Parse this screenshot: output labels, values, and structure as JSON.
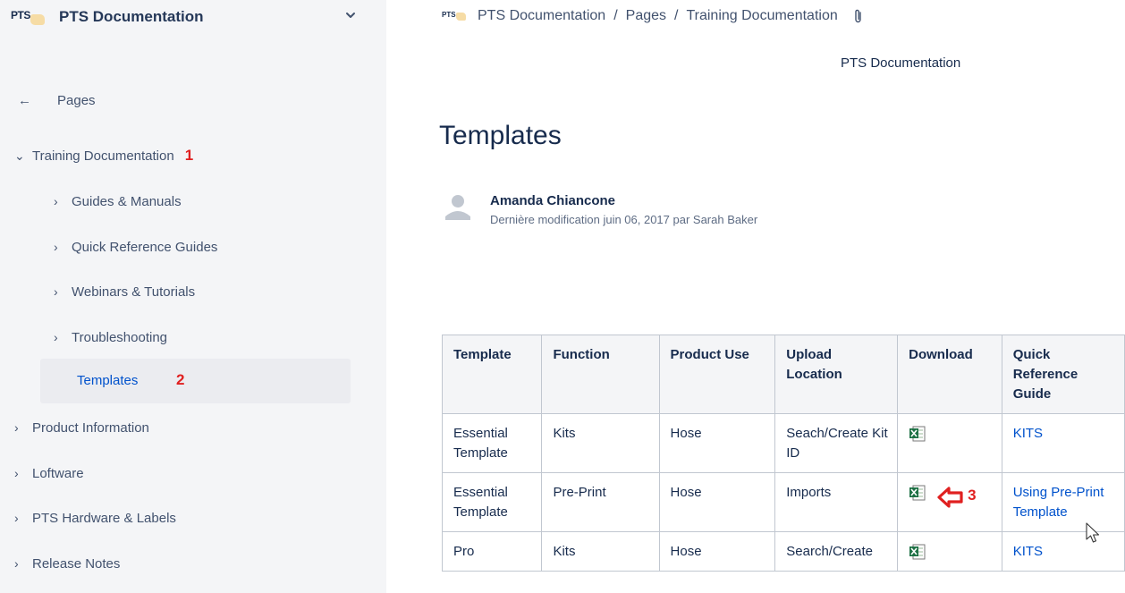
{
  "space": {
    "logo_text": "PTS",
    "name": "PTS Documentation"
  },
  "sidebar": {
    "back_label": "Pages",
    "items": [
      {
        "label": "Training Documentation",
        "expanded": true,
        "marker": "1"
      },
      {
        "label": "Guides & Manuals"
      },
      {
        "label": "Quick Reference Guides"
      },
      {
        "label": "Webinars & Tutorials"
      },
      {
        "label": "Troubleshooting"
      },
      {
        "label": "Templates",
        "selected": true,
        "marker": "2"
      },
      {
        "label": "Product Information"
      },
      {
        "label": "Loftware"
      },
      {
        "label": "PTS Hardware & Labels"
      },
      {
        "label": "Release Notes"
      }
    ]
  },
  "breadcrumb": {
    "logo_text": "PTS",
    "items": [
      "PTS Documentation",
      "Pages",
      "Training Documentation"
    ],
    "separator": "/"
  },
  "page": {
    "space_title": "PTS Documentation",
    "title": "Templates",
    "author": "Amanda Chiancone",
    "modified": "Dernière modification juin 06, 2017 par Sarah Baker"
  },
  "table": {
    "headers": [
      "Template",
      "Function",
      "Product Use",
      "Upload Location",
      "Download",
      "Quick Reference Guide"
    ],
    "rows": [
      {
        "template": "Essential Template",
        "function": "Kits",
        "product_use": "Hose",
        "upload_location": "Seach/Create Kit ID",
        "guide": "KITS"
      },
      {
        "template": "Essential Template",
        "function": "Pre-Print",
        "product_use": "Hose",
        "upload_location": "Imports",
        "guide": "Using Pre-Print Template",
        "marker": "3"
      },
      {
        "template": "Pro",
        "function": "Kits",
        "product_use": "Hose",
        "upload_location": "Search/Create",
        "guide": "KITS"
      }
    ]
  },
  "colors": {
    "sidebar_bg": "#f4f5f7",
    "link": "#0052cc",
    "annotation_red": "#e02020",
    "text": "#172b4d",
    "excel_green": "#1e7145"
  },
  "icons": {
    "space_chevron": "chevron-down-icon",
    "back": "arrow-left-icon",
    "attachment": "paperclip-icon",
    "avatar": "user-avatar-icon",
    "download": "excel-file-icon",
    "callout": "red-arrow-left-icon"
  }
}
